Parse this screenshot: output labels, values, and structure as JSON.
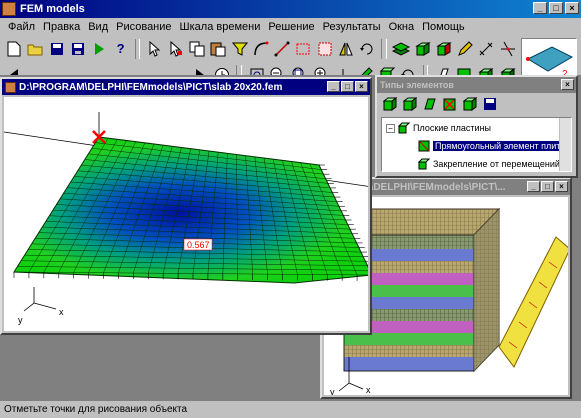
{
  "app": {
    "title": "FEM models"
  },
  "menu": [
    "Файл",
    "Правка",
    "Вид",
    "Рисование",
    "Шкала времени",
    "Решение",
    "Результаты",
    "Окна",
    "Помощь"
  ],
  "main_window": {
    "title": "D:\\PROGRAM\\DELPHI\\FEMmodels\\PICT\\slab 20x20.fem",
    "value_label": "0.567",
    "axis": {
      "x": "x",
      "y": "y"
    }
  },
  "element_types": {
    "title": "Типы элементов",
    "tree": [
      {
        "label": "Плоские пластины",
        "expander": "−"
      },
      {
        "label": "Прямоугольный элемент плиты"
      },
      {
        "label": "Закрепление от перемещений п"
      }
    ]
  },
  "second_window": {
    "title": "ROGRAM\\DELPHI\\FEMmodels\\PICT\\...",
    "axis": {
      "x": "x",
      "y": "y"
    }
  },
  "preview": {
    "label": "2"
  },
  "status": {
    "text": "Отметьте точки для рисования объекта"
  },
  "colors": {
    "titlebar": "#000080",
    "mesh_green": "#00c000",
    "mesh_blue": "#0020c0",
    "cube_olive": "#b8a870",
    "accent_red": "#ff0000"
  }
}
